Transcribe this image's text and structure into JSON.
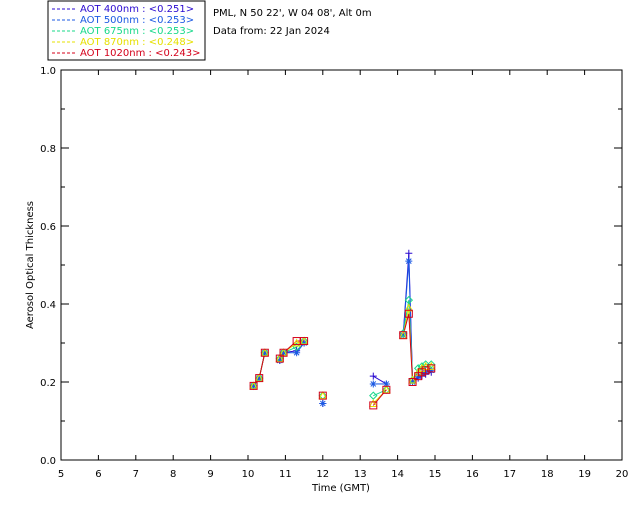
{
  "info": {
    "site": "PML, N 50 22', W 04 08', Alt 0m",
    "date_line": "Data from: 22 Jan 2024"
  },
  "legend": [
    {
      "label": "AOT  400nm : <0.251>",
      "color": "#2a0ad0"
    },
    {
      "label": "AOT  500nm : <0.253>",
      "color": "#1b59e3"
    },
    {
      "label": "AOT  675nm : <0.253>",
      "color": "#18d98a"
    },
    {
      "label": "AOT  870nm : <0.248>",
      "color": "#e6e000"
    },
    {
      "label": "AOT 1020nm : <0.243>",
      "color": "#d4001a"
    }
  ],
  "chart_data": {
    "type": "line",
    "xlabel": "Time (GMT)",
    "ylabel": "Aerosol Optical Thickness",
    "xlim": [
      5,
      20
    ],
    "ylim": [
      0.0,
      1.0
    ],
    "xticks": [
      "5",
      "6",
      "7",
      "8",
      "9",
      "10",
      "11",
      "12",
      "13",
      "14",
      "15",
      "16",
      "17",
      "18",
      "19",
      "20"
    ],
    "yticks": [
      "0.0",
      "0.2",
      "0.4",
      "0.6",
      "0.8",
      "1.0"
    ],
    "grid": false,
    "legend_position": "top-left, above plot",
    "series": [
      {
        "name": "AOT  400nm",
        "marker": "plus",
        "points": [
          [
            10.15,
            0.19
          ],
          [
            10.3,
            0.21
          ],
          [
            10.45,
            0.275
          ],
          [
            10.85,
            0.255
          ],
          [
            10.95,
            0.275
          ],
          [
            11.3,
            0.28
          ],
          [
            11.5,
            0.3
          ],
          [
            12.0,
            0.145
          ],
          [
            13.35,
            0.215
          ],
          [
            13.7,
            0.195
          ],
          [
            14.15,
            0.32
          ],
          [
            14.3,
            0.53
          ],
          [
            14.4,
            0.2
          ],
          [
            14.55,
            0.21
          ],
          [
            14.65,
            0.215
          ],
          [
            14.75,
            0.22
          ],
          [
            14.9,
            0.225
          ]
        ]
      },
      {
        "name": "AOT  500nm",
        "marker": "asterisk",
        "points": [
          [
            10.15,
            0.19
          ],
          [
            10.3,
            0.21
          ],
          [
            10.45,
            0.275
          ],
          [
            10.85,
            0.255
          ],
          [
            10.95,
            0.275
          ],
          [
            11.3,
            0.275
          ],
          [
            11.5,
            0.3
          ],
          [
            12.0,
            0.145
          ],
          [
            13.35,
            0.195
          ],
          [
            13.7,
            0.195
          ],
          [
            14.15,
            0.32
          ],
          [
            14.3,
            0.51
          ],
          [
            14.4,
            0.2
          ],
          [
            14.55,
            0.215
          ],
          [
            14.65,
            0.22
          ],
          [
            14.75,
            0.225
          ],
          [
            14.9,
            0.23
          ]
        ]
      },
      {
        "name": "AOT  675nm",
        "marker": "diamond",
        "points": [
          [
            10.15,
            0.19
          ],
          [
            10.3,
            0.21
          ],
          [
            10.45,
            0.275
          ],
          [
            10.85,
            0.26
          ],
          [
            10.95,
            0.275
          ],
          [
            11.3,
            0.29
          ],
          [
            11.5,
            0.305
          ],
          [
            12.0,
            0.165
          ],
          [
            13.35,
            0.165
          ],
          [
            13.7,
            0.18
          ],
          [
            14.15,
            0.325
          ],
          [
            14.3,
            0.41
          ],
          [
            14.4,
            0.205
          ],
          [
            14.55,
            0.235
          ],
          [
            14.65,
            0.24
          ],
          [
            14.75,
            0.245
          ],
          [
            14.9,
            0.245
          ]
        ]
      },
      {
        "name": "AOT  870nm",
        "marker": "triangle",
        "points": [
          [
            10.15,
            0.19
          ],
          [
            10.3,
            0.21
          ],
          [
            10.45,
            0.275
          ],
          [
            10.85,
            0.26
          ],
          [
            10.95,
            0.275
          ],
          [
            11.3,
            0.3
          ],
          [
            11.5,
            0.305
          ],
          [
            12.0,
            0.165
          ],
          [
            13.35,
            0.145
          ],
          [
            13.7,
            0.18
          ],
          [
            14.15,
            0.32
          ],
          [
            14.3,
            0.39
          ],
          [
            14.4,
            0.205
          ],
          [
            14.55,
            0.225
          ],
          [
            14.65,
            0.235
          ],
          [
            14.75,
            0.24
          ],
          [
            14.9,
            0.24
          ]
        ]
      },
      {
        "name": "AOT 1020nm",
        "marker": "square",
        "points": [
          [
            10.15,
            0.19
          ],
          [
            10.3,
            0.21
          ],
          [
            10.45,
            0.275
          ],
          [
            10.85,
            0.26
          ],
          [
            10.95,
            0.275
          ],
          [
            11.3,
            0.305
          ],
          [
            11.5,
            0.305
          ],
          [
            12.0,
            0.165
          ],
          [
            13.35,
            0.14
          ],
          [
            13.7,
            0.18
          ],
          [
            14.15,
            0.32
          ],
          [
            14.3,
            0.375
          ],
          [
            14.4,
            0.2
          ],
          [
            14.55,
            0.215
          ],
          [
            14.65,
            0.225
          ],
          [
            14.75,
            0.23
          ],
          [
            14.9,
            0.235
          ]
        ]
      }
    ]
  }
}
